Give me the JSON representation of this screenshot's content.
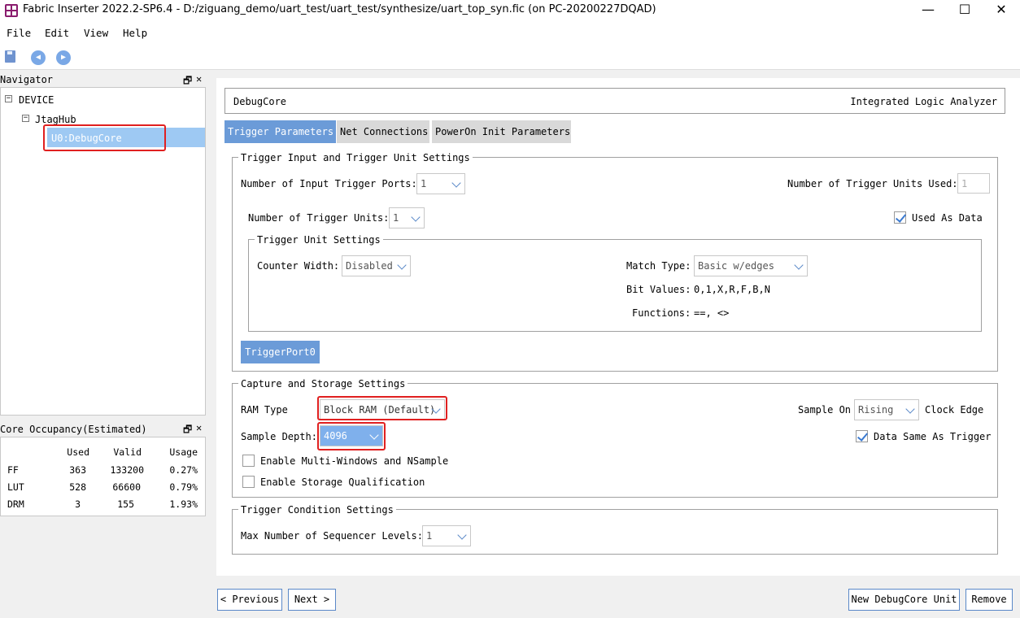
{
  "window": {
    "title": "Fabric Inserter 2022.2-SP6.4 - D:/ziguang_demo/uart_test/uart_test/synthesize/uart_top_syn.fic (on PC-20200227DQAD)",
    "minimize": "—",
    "maximize": "☐",
    "close": "✕"
  },
  "menu": {
    "file": "File",
    "edit": "Edit",
    "view": "View",
    "help": "Help"
  },
  "toolbar": {
    "save_icon": "save-icon",
    "back_icon": "arrow-left-icon",
    "forward_icon": "arrow-right-icon"
  },
  "navigator": {
    "title": "Navigator",
    "float": "🗗",
    "close": "✕",
    "tree": {
      "device": "DEVICE",
      "hub": "JtagHub",
      "core": "U0:DebugCore",
      "collapse": "−"
    }
  },
  "occupancy": {
    "title": "Core Occupancy(Estimated)",
    "float": "🗗",
    "close": "✕",
    "headers": [
      "",
      "Used",
      "Valid",
      "Usage"
    ],
    "rows": [
      [
        "FF",
        "363",
        "133200",
        "0.27%"
      ],
      [
        "LUT",
        "528",
        "66600",
        "0.79%"
      ],
      [
        "DRM",
        "3",
        "155",
        "1.93%"
      ]
    ]
  },
  "header": {
    "left": "DebugCore",
    "right": "Integrated Logic Analyzer"
  },
  "tabs": [
    "Trigger Parameters",
    "Net Connections",
    "PowerOn Init Parameters"
  ],
  "trigger_input": {
    "legend": "Trigger Input and Trigger Unit Settings",
    "ports_label": "Number of Input Trigger Ports:",
    "ports_value": "1",
    "units_used_label": "Number of Trigger Units Used:",
    "units_used_value": "1",
    "units_label": "Number of Trigger Units:",
    "units_value": "1",
    "used_as_data": "Used As Data",
    "unit_settings": {
      "legend": "Trigger Unit Settings",
      "counter_label": "Counter Width:",
      "counter_value": "Disabled",
      "match_label": "Match Type:",
      "match_value": "Basic w/edges",
      "bit_values_label": "Bit Values:",
      "bit_values": "0,1,X,R,F,B,N",
      "functions_label": "Functions:",
      "functions": "==, <>"
    },
    "port_button": "TriggerPort0"
  },
  "capture": {
    "legend": "Capture and Storage Settings",
    "ram_label": "RAM Type",
    "ram_value": "Block RAM (Default)",
    "sample_on_label": "Sample On",
    "sample_on_value": "Rising",
    "clock_edge": "Clock Edge",
    "depth_label": "Sample Depth:",
    "depth_value": "4096",
    "data_same": "Data Same As Trigger",
    "multi_windows": "Enable Multi-Windows and NSample",
    "storage_qual": "Enable Storage Qualification"
  },
  "condition": {
    "legend": "Trigger Condition Settings",
    "levels_label": "Max Number of Sequencer Levels:",
    "levels_value": "1"
  },
  "buttons": {
    "previous": "< Previous",
    "next": "Next >",
    "new_unit": "New DebugCore Unit",
    "remove": "Remove"
  }
}
